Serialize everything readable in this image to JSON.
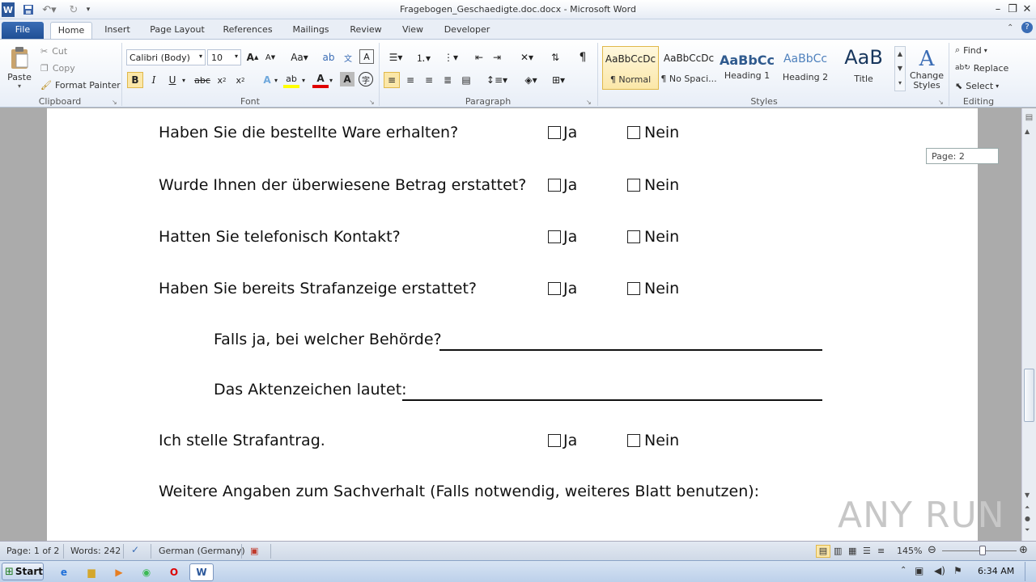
{
  "window": {
    "title": "Fragebogen_Geschaedigte.doc.docx - Microsoft Word"
  },
  "tabs": [
    {
      "label": "File"
    },
    {
      "label": "Home"
    },
    {
      "label": "Insert"
    },
    {
      "label": "Page Layout"
    },
    {
      "label": "References"
    },
    {
      "label": "Mailings"
    },
    {
      "label": "Review"
    },
    {
      "label": "View"
    },
    {
      "label": "Developer"
    }
  ],
  "ribbon": {
    "clipboard": {
      "paste": "Paste",
      "cut": "Cut",
      "copy": "Copy",
      "format_painter": "Format Painter",
      "label": "Clipboard"
    },
    "font": {
      "family": "Calibri (Body)",
      "size": "10",
      "label": "Font"
    },
    "paragraph": {
      "label": "Paragraph"
    },
    "styles": {
      "items": [
        {
          "preview": "AaBbCcDc",
          "label": "¶ Normal"
        },
        {
          "preview": "AaBbCcDc",
          "label": "¶ No Spaci..."
        },
        {
          "preview": "AaBbCc",
          "label": "Heading 1"
        },
        {
          "preview": "AaBbCc",
          "label": "Heading 2"
        },
        {
          "preview": "AaB",
          "label": "Title"
        }
      ],
      "change_styles": "Change Styles",
      "label": "Styles"
    },
    "editing": {
      "find": "Find",
      "replace": "Replace",
      "select": "Select",
      "label": "Editing"
    }
  },
  "document": {
    "questions": [
      {
        "text": "Haben Sie die bestellte Ware erhalten?",
        "yes": "Ja",
        "no": "Nein"
      },
      {
        "text": "Wurde Ihnen der überwiesene Betrag erstattet?",
        "yes": "Ja",
        "no": "Nein"
      },
      {
        "text": "Hatten Sie telefonisch Kontakt?",
        "yes": "Ja",
        "no": "Nein"
      },
      {
        "text": "Haben Sie bereits Strafanzeige erstattet?",
        "yes": "Ja",
        "no": "Nein"
      }
    ],
    "followups": [
      {
        "text": "Falls ja, bei welcher Behörde?"
      },
      {
        "text": "Das Aktenzeichen lautet:"
      }
    ],
    "strafantrag": {
      "text": "Ich stelle Strafantrag.",
      "yes": "Ja",
      "no": "Nein"
    },
    "weitere": "Weitere Angaben zum Sachverhalt (Falls notwendig, weiteres Blatt benutzen):"
  },
  "page_tooltip": "Page: 2",
  "status": {
    "page": "Page: 1 of 2",
    "words": "Words: 242",
    "language": "German (Germany)",
    "zoom": "145%"
  },
  "taskbar": {
    "start": "Start",
    "time": "6:34 AM"
  },
  "watermark": "ANY RUN"
}
